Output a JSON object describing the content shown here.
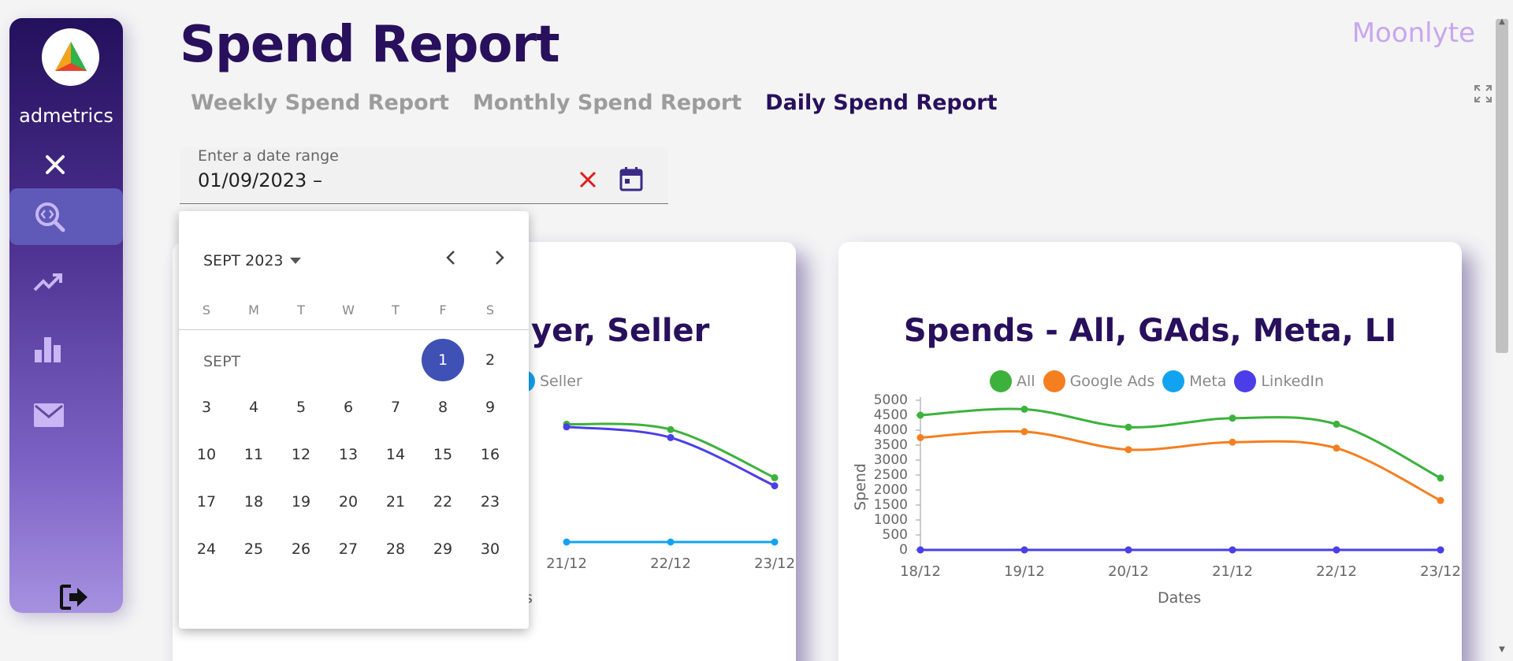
{
  "sidebar": {
    "logo_text": "admetrics",
    "items": [
      {
        "name": "search-analytics",
        "icon": "search-code-icon",
        "active": true
      },
      {
        "name": "trends",
        "icon": "trending-up-icon",
        "active": false
      },
      {
        "name": "bar-chart",
        "icon": "bar-chart-icon",
        "active": false
      },
      {
        "name": "mail",
        "icon": "mail-icon",
        "active": false
      }
    ]
  },
  "header": {
    "title": "Spend Report",
    "brand": "Moonlyte",
    "tabs": [
      {
        "label": "Weekly Spend Report",
        "active": false
      },
      {
        "label": "Monthly Spend Report",
        "active": false
      },
      {
        "label": "Daily Spend Report",
        "active": true
      }
    ]
  },
  "date_range": {
    "label": "Enter a date range",
    "value": "01/09/2023 –"
  },
  "calendar": {
    "period_label": "SEPT 2023",
    "month_label": "SEPT",
    "weekdays": [
      "S",
      "M",
      "T",
      "W",
      "T",
      "F",
      "S"
    ],
    "selected_day": 1,
    "first_weekday_index": 5,
    "days_in_month": 30
  },
  "colors": {
    "all": "#3cb23c",
    "google_ads": "#f47f20",
    "meta": "#12a3f0",
    "linkedin": "#4b3ee8",
    "accent": "#3f51b5",
    "title": "#28105c"
  },
  "chart_data": [
    {
      "type": "line",
      "title": "yer, Seller",
      "legend": [
        "Seller"
      ],
      "x": [
        "21/12",
        "22/12",
        "23/12"
      ],
      "xlabel": "s",
      "series": [
        {
          "name": "",
          "color": "#3cb23c",
          "values": [
            4400,
            4200,
            2400
          ]
        },
        {
          "name": "",
          "color": "#4b3ee8",
          "values": [
            4300,
            3900,
            2100
          ]
        },
        {
          "name": "Seller",
          "color": "#12a3f0",
          "values": [
            0,
            0,
            0
          ]
        }
      ],
      "ylim": [
        0,
        5000
      ]
    },
    {
      "type": "line",
      "title": "Spends - All, GAds, Meta, LI",
      "legend": [
        "All",
        "Google Ads",
        "Meta",
        "LinkedIn"
      ],
      "x": [
        "18/12",
        "19/12",
        "20/12",
        "21/12",
        "22/12",
        "23/12"
      ],
      "xlabel": "Dates",
      "ylabel": "Spend",
      "yticks": [
        "5000",
        "4500",
        "4000",
        "3500",
        "3000",
        "2500",
        "2000",
        "1500",
        "1000",
        "500",
        "0"
      ],
      "ylim": [
        0,
        5000
      ],
      "series": [
        {
          "name": "All",
          "color": "#3cb23c",
          "values": [
            4500,
            4700,
            4100,
            4400,
            4200,
            2400
          ]
        },
        {
          "name": "Google Ads",
          "color": "#f47f20",
          "values": [
            3750,
            3950,
            3350,
            3600,
            3400,
            1650
          ]
        },
        {
          "name": "Meta",
          "color": "#12a3f0",
          "values": [
            0,
            0,
            0,
            0,
            0,
            0
          ]
        },
        {
          "name": "LinkedIn",
          "color": "#4b3ee8",
          "values": [
            0,
            0,
            0,
            0,
            0,
            0
          ]
        }
      ]
    }
  ]
}
